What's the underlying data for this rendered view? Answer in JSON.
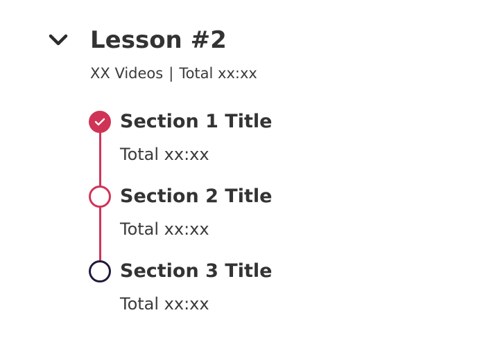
{
  "lesson": {
    "title": "Lesson #2",
    "videos": "XX Videos",
    "separator": "|",
    "total": "Total xx:xx",
    "toggle_icon": "chevron-down-icon"
  },
  "colors": {
    "accent": "#cf3457",
    "upcoming": "#1d1b3c",
    "text": "#333333"
  },
  "sections": [
    {
      "title": "Section 1 Title",
      "total": "Total xx:xx",
      "status": "completed",
      "icon": "check-circle-icon"
    },
    {
      "title": "Section 2 Title",
      "total": "Total xx:xx",
      "status": "in-progress",
      "icon": "circle-outline-icon"
    },
    {
      "title": "Section 3 Title",
      "total": "Total xx:xx",
      "status": "not-started",
      "icon": "circle-outline-icon"
    }
  ]
}
